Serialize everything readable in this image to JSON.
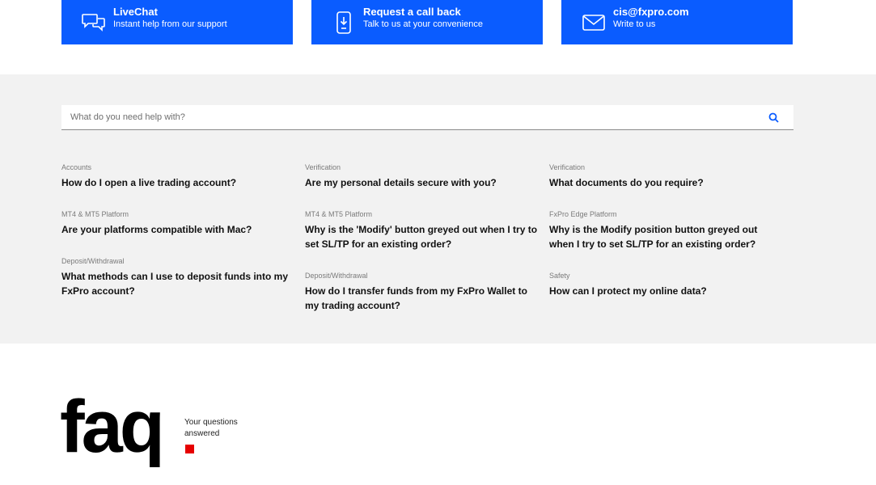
{
  "contact": [
    {
      "title": "LiveChat",
      "subtitle": "Instant help from our support",
      "icon": "chat-icon"
    },
    {
      "title": "Request a call back",
      "subtitle": "Talk to us at your convenience",
      "icon": "phone-icon"
    },
    {
      "title": "cis@fxpro.com",
      "subtitle": "Write to us",
      "icon": "mail-icon"
    }
  ],
  "search": {
    "placeholder": "What do you need help with?",
    "icon": "search-icon"
  },
  "faqs": [
    {
      "category": "Accounts",
      "question": "How do I open a live trading account?"
    },
    {
      "category": "Verification",
      "question": "Are my personal details secure with you?"
    },
    {
      "category": "Verification",
      "question": "What documents do you require?"
    },
    {
      "category": "MT4 & MT5 Platform",
      "question": "Are your platforms compatible with Mac?"
    },
    {
      "category": "MT4 & MT5 Platform",
      "question": "Why is the 'Modify' button greyed out when I try to set SL/TP for an existing order?"
    },
    {
      "category": "FxPro Edge Platform",
      "question": "Why is the Modify position button greyed out when I try to set SL/TP for an existing order?"
    },
    {
      "category": "Deposit/Withdrawal",
      "question": "What methods can I use to deposit funds into my FxPro account?"
    },
    {
      "category": "Deposit/Withdrawal",
      "question": "How do I transfer funds from my FxPro Wallet to my trading account?"
    },
    {
      "category": "Safety",
      "question": "How can I protect my online data?"
    }
  ],
  "brand": {
    "logo_text": "faq",
    "tagline": "Your questions answered",
    "accent_color": "#e60000",
    "primary_color": "#0a5cff"
  }
}
